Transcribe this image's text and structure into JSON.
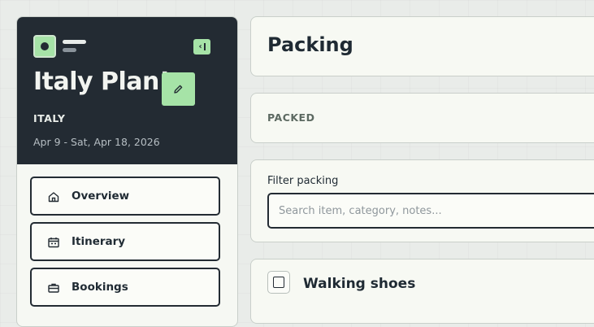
{
  "sidebar": {
    "trip": {
      "title": "Italy Plan!",
      "country": "ITALY",
      "dates": "Apr 9 - Sat, Apr 18, 2026"
    },
    "nav": [
      {
        "label": "Overview",
        "icon": "home-icon"
      },
      {
        "label": "Itinerary",
        "icon": "calendar-icon"
      },
      {
        "label": "Bookings",
        "icon": "briefcase-icon"
      }
    ]
  },
  "main": {
    "page_title": "Packing",
    "packed_label": "PACKED",
    "filter": {
      "label": "Filter packing",
      "placeholder": "Search item, category, notes..."
    },
    "items": [
      {
        "name": "Walking shoes",
        "packed": false
      }
    ]
  },
  "colors": {
    "accent": "#a6e3a7",
    "dark": "#232b33",
    "surface": "#f7f9f3"
  }
}
